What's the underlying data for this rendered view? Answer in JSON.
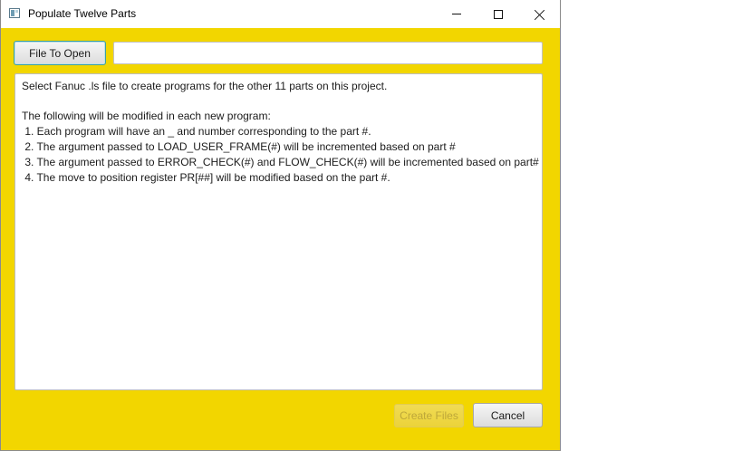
{
  "window": {
    "title": "Populate Twelve Parts",
    "background": "#f2d600"
  },
  "toolbar": {
    "file_button_label": "File To Open",
    "file_path_value": ""
  },
  "info": {
    "intro": "Select Fanuc .ls file to create programs for the other 11 parts on this project.",
    "heading": "The following will be modified in each new program:",
    "items": [
      " 1. Each program will have an _ and number corresponding to the part #.",
      " 2. The argument passed to LOAD_USER_FRAME(#) will be incremented based on part #",
      " 3. The argument passed to ERROR_CHECK(#) and FLOW_CHECK(#) will be incremented based on part#",
      " 4. The move to position register PR[##] will be modified based on the part #."
    ]
  },
  "footer": {
    "create_label": "Create Files",
    "create_enabled": false,
    "cancel_label": "Cancel"
  }
}
